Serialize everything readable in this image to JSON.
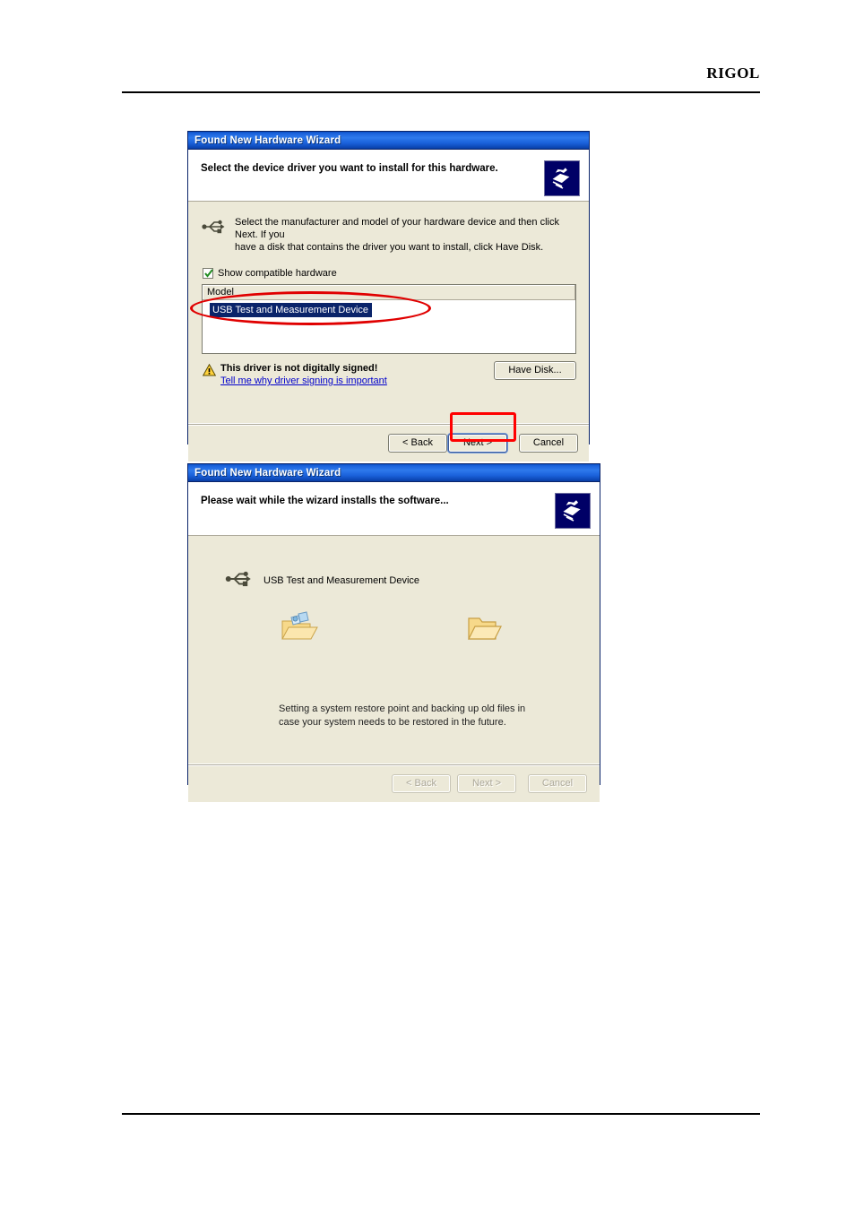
{
  "page": {
    "brand": "RIGOL"
  },
  "dialog1": {
    "title": "Found New Hardware Wizard",
    "banner_heading": "Select the device driver you want to install for this hardware.",
    "instruction_line1": "Select the manufacturer and model of your hardware device and then click Next. If you",
    "instruction_line2": "have a disk that contains the driver you want to install, click Have Disk.",
    "checkbox_label": "Show compatible hardware",
    "checkbox_checked": "true",
    "list_header": "Model",
    "list_items": [
      "USB Test and Measurement Device"
    ],
    "warning_title": "This driver is not digitally signed!",
    "warning_link": "Tell me why driver signing is important",
    "have_disk_label": "Have Disk...",
    "buttons": {
      "back": "< Back",
      "next": "Next >",
      "cancel": "Cancel"
    },
    "icons": {
      "header": "wizard-hand-card-icon",
      "device": "usb-icon",
      "warning": "warning-triangle-icon",
      "checkbox": "checkmark-icon"
    },
    "annotations": {
      "oval_target": "USB Test and Measurement Device",
      "rect_target": "Next >",
      "color": "#ff0000"
    }
  },
  "dialog2": {
    "title": "Found New Hardware Wizard",
    "banner_heading": "Please wait while the wizard installs the software...",
    "device_label": "USB Test and Measurement Device",
    "status_line1": "Setting a system restore point and backing up old files in",
    "status_line2": "case your system needs to be restored in the future.",
    "buttons": {
      "back": "< Back",
      "next": "Next >",
      "cancel": "Cancel"
    },
    "buttons_disabled": "true",
    "icons": {
      "header": "wizard-hand-card-icon",
      "device": "usb-icon",
      "source": "folder-copy-files-icon",
      "destination": "folder-open-icon"
    }
  }
}
